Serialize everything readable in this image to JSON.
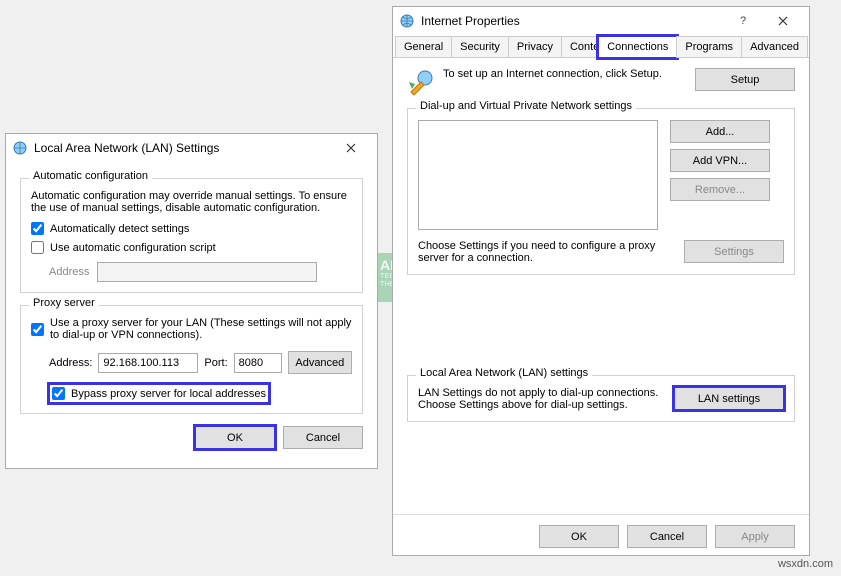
{
  "watermark": {
    "brand": "APPUALS",
    "tagline": "TECH HOW-TO'S FROM THE EXPERTS"
  },
  "footer_credit": "wsxdn.com",
  "lan": {
    "title": "Local Area Network (LAN) Settings",
    "auto_group": "Automatic configuration",
    "auto_desc": "Automatic configuration may override manual settings.  To ensure the use of manual settings, disable automatic configuration.",
    "auto_detect": "Automatically detect settings",
    "use_script": "Use automatic configuration script",
    "address_label": "Address",
    "proxy_group": "Proxy server",
    "use_proxy": "Use a proxy server for your LAN (These settings will not apply to dial-up or VPN connections).",
    "addr_label": "Address:",
    "addr_value": "92.168.100.113",
    "port_label": "Port:",
    "port_value": "8080",
    "advanced_btn": "Advanced",
    "bypass": "Bypass proxy server for local addresses",
    "ok": "OK",
    "cancel": "Cancel"
  },
  "ip": {
    "title": "Internet Properties",
    "tabs": {
      "general": "General",
      "security": "Security",
      "privacy": "Privacy",
      "content": "Content",
      "connections": "Connections",
      "programs": "Programs",
      "advanced": "Advanced"
    },
    "setup_text": "To set up an Internet connection, click Setup.",
    "setup_btn": "Setup",
    "dialup_group": "Dial-up and Virtual Private Network settings",
    "add_btn": "Add...",
    "addvpn_btn": "Add VPN...",
    "remove_btn": "Remove...",
    "settings_btn": "Settings",
    "choose_text": "Choose Settings if you need to configure a proxy server for a connection.",
    "lan_group": "Local Area Network (LAN) settings",
    "lan_desc": "LAN Settings do not apply to dial-up connections. Choose Settings above for dial-up settings.",
    "lan_btn": "LAN settings",
    "ok": "OK",
    "cancel": "Cancel",
    "apply": "Apply"
  }
}
